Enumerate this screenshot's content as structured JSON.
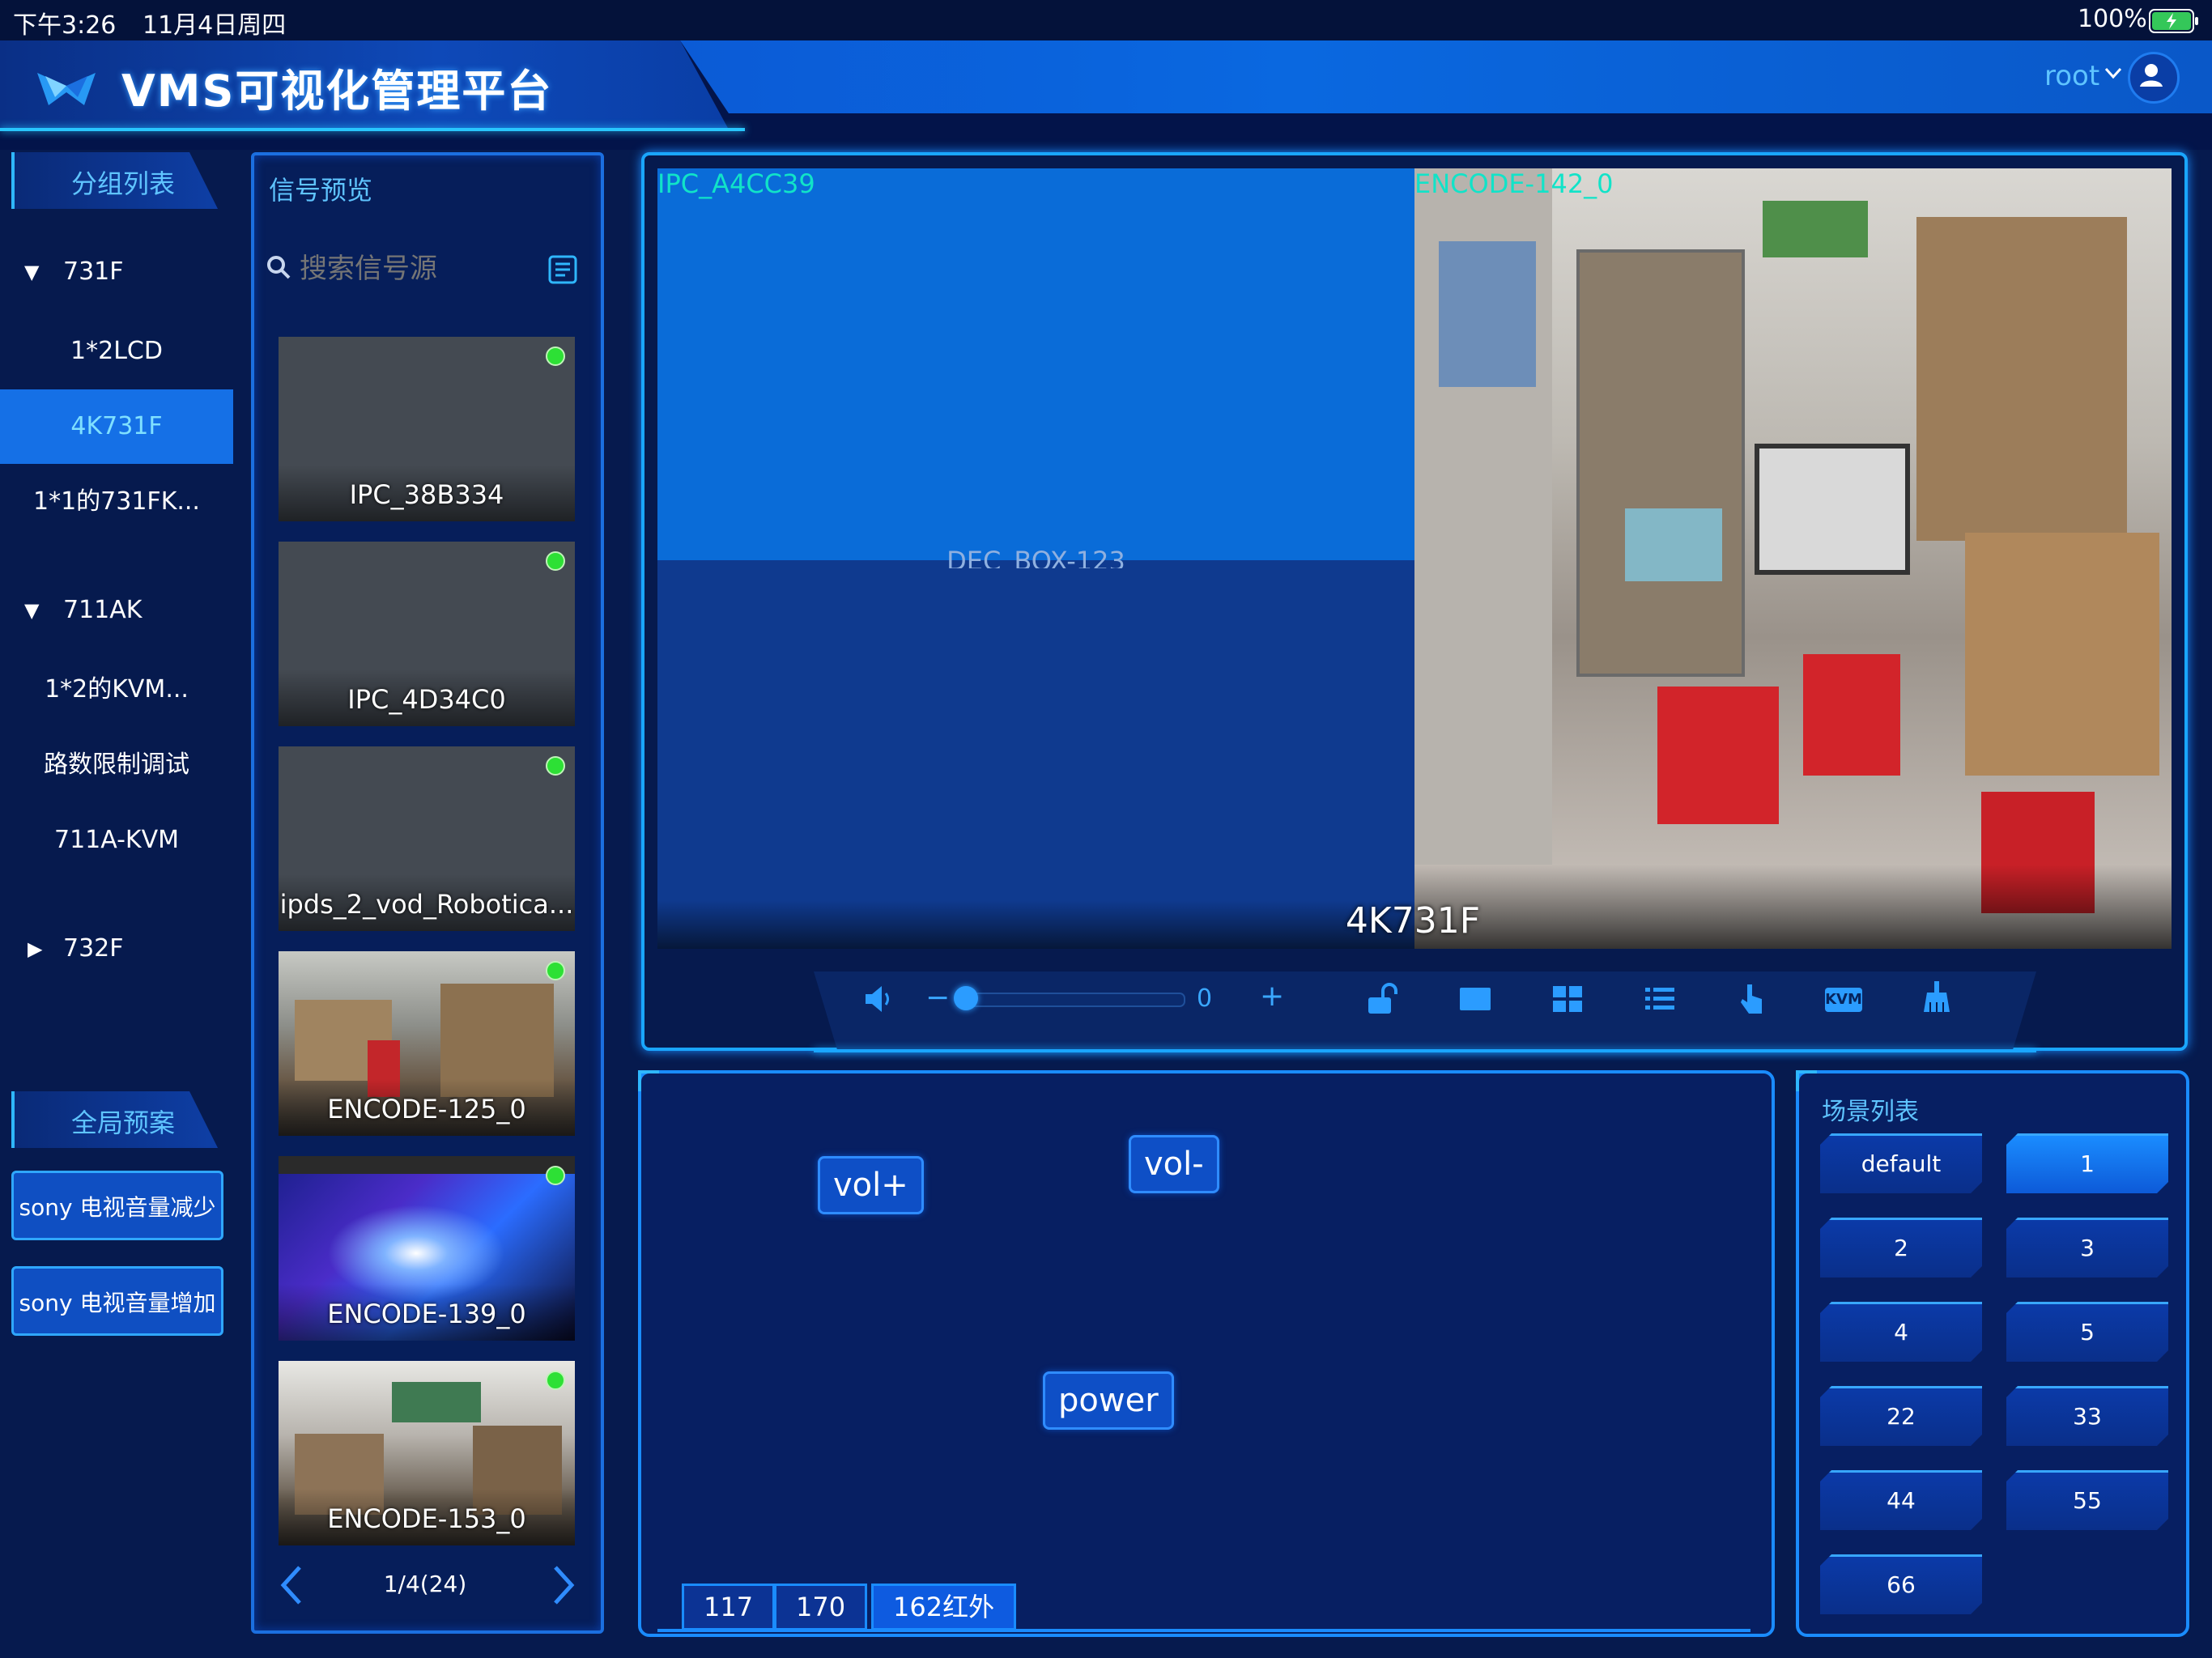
{
  "status_bar": {
    "time": "下午3:26",
    "date": "11月4日周四",
    "battery": "100%"
  },
  "header": {
    "title": "VMS可视化管理平台",
    "user": "root"
  },
  "group_list": {
    "title": "分组列表",
    "groups": [
      {
        "name": "731F",
        "expanded": true,
        "items": [
          "1*2LCD",
          "4K731F",
          "1*1的731FK..."
        ]
      },
      {
        "name": "711AK",
        "expanded": true,
        "items": [
          "1*2的KVM...",
          "路数限制调试",
          "711A-KVM"
        ]
      },
      {
        "name": "732F",
        "expanded": false,
        "items": []
      }
    ],
    "active_item": "4K731F"
  },
  "global_presets": {
    "title": "全局预案",
    "items": [
      "sony 电视音量减少",
      "sony 电视音量增加"
    ]
  },
  "signal_preview": {
    "title": "信号预览",
    "search_placeholder": "搜索信号源",
    "sources": [
      {
        "name": "IPC_38B334",
        "online": true
      },
      {
        "name": "IPC_4D34C0",
        "online": true
      },
      {
        "name": "ipds_2_vod_Robotica...",
        "online": true
      },
      {
        "name": "ENCODE-125_0",
        "online": true
      },
      {
        "name": "ENCODE-139_0",
        "online": true
      },
      {
        "name": "ENCODE-153_0",
        "online": true
      }
    ],
    "pager": "1/4(24)"
  },
  "video_wall": {
    "name": "4K731F",
    "windows": [
      {
        "label": "IPC_A4CC39",
        "color": "#0a6cd8"
      },
      {
        "label": "DEC_BOX-123",
        "color": "#0f3a8f"
      },
      {
        "label": "ENCODE-142_0",
        "color": "#8a8a86"
      }
    ]
  },
  "toolbar": {
    "volume_value": "0",
    "minus": "−",
    "plus": "+",
    "icons": [
      "speaker-icon",
      "unlock-icon",
      "single-screen-icon",
      "grid-icon",
      "list-icon",
      "touch-icon",
      "kvm-icon",
      "sweep-icon"
    ],
    "kvm_label": "KVM"
  },
  "remote": {
    "buttons": {
      "vol_plus": "vol+",
      "vol_minus": "vol-",
      "power": "power"
    },
    "tabs": [
      "117",
      "170",
      "162红外"
    ],
    "active_tab": "162红外"
  },
  "scene_list": {
    "title": "场景列表",
    "scenes": [
      "default",
      "1",
      "2",
      "3",
      "4",
      "5",
      "22",
      "33",
      "44",
      "55",
      "66"
    ],
    "active": "1"
  },
  "colors": {
    "accent": "#1aa6ff",
    "background": "#061a4e",
    "active": "#1570e6",
    "online": "#2de035"
  }
}
